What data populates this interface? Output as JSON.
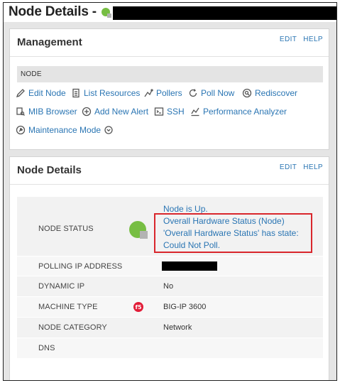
{
  "page": {
    "title": "Node Details -"
  },
  "management": {
    "title": "Management",
    "edit": "EDIT",
    "help": "HELP",
    "section_label": "NODE",
    "actions": [
      {
        "label": "Edit Node",
        "icon": "pencil-icon"
      },
      {
        "label": "List Resources",
        "icon": "list-document-icon"
      },
      {
        "label": "Pollers",
        "icon": "pollers-icon"
      },
      {
        "label": "Poll Now",
        "icon": "refresh-icon"
      },
      {
        "label": "Rediscover",
        "icon": "rediscover-icon"
      },
      {
        "label": "MIB Browser",
        "icon": "mib-browser-icon"
      },
      {
        "label": "Add New Alert",
        "icon": "plus-circle-icon"
      },
      {
        "label": "SSH",
        "icon": "terminal-icon"
      },
      {
        "label": "Performance Analyzer",
        "icon": "chart-icon"
      },
      {
        "label": "Maintenance Mode",
        "icon": "maintenance-icon"
      }
    ]
  },
  "node_details": {
    "title": "Node Details",
    "edit": "EDIT",
    "help": "HELP",
    "status": {
      "label": "NODE STATUS",
      "lines": [
        "Node is Up.",
        "Overall Hardware Status (Node)",
        "'Overall Hardware Status' has state:",
        "Could Not Poll."
      ],
      "status_color": "#77be43"
    },
    "rows": [
      {
        "label": "POLLING IP ADDRESS",
        "value": ""
      },
      {
        "label": "DYNAMIC IP",
        "value": "No"
      },
      {
        "label": "MACHINE TYPE",
        "value": "BIG-IP 3600",
        "vendor_icon": "f5-logo-icon"
      },
      {
        "label": "NODE CATEGORY",
        "value": "Network"
      },
      {
        "label": "DNS",
        "value": ""
      }
    ]
  },
  "colors": {
    "link": "#2a75b3",
    "highlight": "#d9262c",
    "status_up": "#77be43"
  }
}
